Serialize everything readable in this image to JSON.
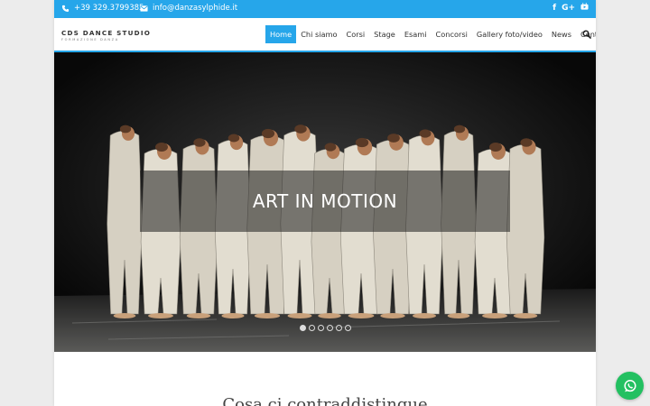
{
  "topbar": {
    "phone": "+39 329.3799385",
    "email": "info@danzasylphide.it",
    "phone_icon": "phone-icon",
    "email_icon": "envelope-icon",
    "social": [
      {
        "name": "facebook-icon",
        "glyph": "f"
      },
      {
        "name": "google-plus-icon",
        "glyph": "G+"
      },
      {
        "name": "youtube-icon",
        "glyph": "▶"
      }
    ]
  },
  "logo": {
    "title": "CDS DANCE STUDIO",
    "subtitle": "FORMAZIONE DANZA"
  },
  "nav": {
    "items": [
      {
        "label": "Home",
        "active": true
      },
      {
        "label": "Chi siamo"
      },
      {
        "label": "Corsi"
      },
      {
        "label": "Stage"
      },
      {
        "label": "Esami"
      },
      {
        "label": "Concorsi"
      },
      {
        "label": "Gallery foto/video"
      },
      {
        "label": "News"
      },
      {
        "label": "Contatti"
      }
    ],
    "search_icon": "search-icon"
  },
  "hero": {
    "caption": "ART IN MOTION",
    "slides": 6,
    "active_slide": 0
  },
  "section": {
    "title": "Cosa ci contraddistingue"
  },
  "floating": {
    "icon": "whatsapp-icon"
  },
  "colors": {
    "accent": "#26a6ea",
    "whatsapp": "#23c061"
  }
}
